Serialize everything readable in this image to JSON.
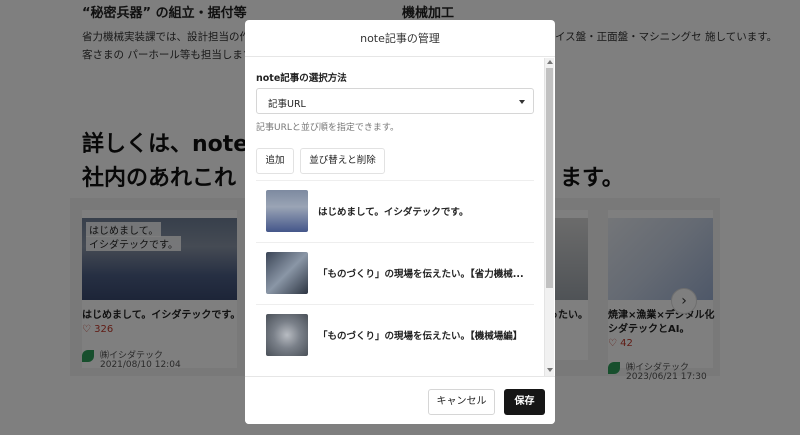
{
  "background": {
    "left_section_title": "“秘密兵器” の組立・据付等",
    "right_section_title": "機械加工",
    "left_section_body": "省力機械実装課では、設計担当の作 装置の組立を行います。お客さまの パーホール等も担当します。",
    "right_section_body": "イス盤・正面盤・マシニングセ 施しています。",
    "heading_line1": "詳しくは、note",
    "heading_line2": "社内のあれこれ",
    "heading_line2_tail": "ます。",
    "cards": [
      {
        "thumb_text_1": "はじめまして。",
        "thumb_text_2": "イシダテックです。",
        "title": "はじめまして。イシダテックです。",
        "likes": "♡ 326",
        "author": "㈱イシダテック",
        "date": "2021/08/10 12:04"
      },
      {
        "title": "ったい。"
      },
      {
        "title_line1": "焼津×漁業×デジタル化",
        "title_line2": "シダテックとAI。",
        "likes": "♡ 42",
        "author": "㈱イシダテック",
        "date": "2023/06/21 17:30"
      }
    ],
    "carousel_next_icon": "›"
  },
  "modal": {
    "title": "note記事の管理",
    "field_label": "note記事の選択方法",
    "select_value": "記事URL",
    "helper_text": "記事URLと並び順を指定できます。",
    "tabs": [
      {
        "label": "追加"
      },
      {
        "label": "並び替えと削除"
      }
    ],
    "items": [
      {
        "title": "はじめまして。イシダテックです。"
      },
      {
        "title": "「ものづくり」の現場を伝えたい。【省力機械..."
      },
      {
        "title": "「ものづくり」の現場を伝えたい。【機械場編】"
      }
    ],
    "cancel_label": "キャンセル",
    "save_label": "保存"
  },
  "colors": {
    "overlay": "rgba(0,0,0,0.5)",
    "save_button": "#161616",
    "like_red": "#c0392b",
    "brand_green": "#2e9e5b"
  }
}
